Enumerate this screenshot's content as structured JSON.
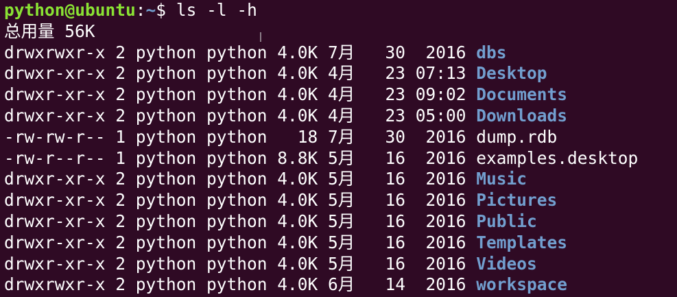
{
  "prompt": {
    "user_host": "python@ubuntu",
    "separator": ":",
    "path": "~",
    "symbol": "$",
    "command": " ls -l -h"
  },
  "total_line": "总用量 56K",
  "entries": [
    {
      "perms": "drwxrwxr-x",
      "links": "2",
      "owner": "python",
      "group": "python",
      "size": "4.0K",
      "month": "7月",
      "day": "30",
      "time": "2016",
      "name": "dbs",
      "type": "dir"
    },
    {
      "perms": "drwxr-xr-x",
      "links": "2",
      "owner": "python",
      "group": "python",
      "size": "4.0K",
      "month": "4月",
      "day": "23",
      "time": "07:13",
      "name": "Desktop",
      "type": "dir"
    },
    {
      "perms": "drwxr-xr-x",
      "links": "2",
      "owner": "python",
      "group": "python",
      "size": "4.0K",
      "month": "4月",
      "day": "23",
      "time": "09:02",
      "name": "Documents",
      "type": "dir"
    },
    {
      "perms": "drwxr-xr-x",
      "links": "2",
      "owner": "python",
      "group": "python",
      "size": "4.0K",
      "month": "4月",
      "day": "23",
      "time": "05:00",
      "name": "Downloads",
      "type": "dir"
    },
    {
      "perms": "-rw-rw-r--",
      "links": "1",
      "owner": "python",
      "group": "python",
      "size": "  18",
      "month": "7月",
      "day": "30",
      "time": "2016",
      "name": "dump.rdb",
      "type": "file"
    },
    {
      "perms": "-rw-r--r--",
      "links": "1",
      "owner": "python",
      "group": "python",
      "size": "8.8K",
      "month": "5月",
      "day": "16",
      "time": "2016",
      "name": "examples.desktop",
      "type": "file"
    },
    {
      "perms": "drwxr-xr-x",
      "links": "2",
      "owner": "python",
      "group": "python",
      "size": "4.0K",
      "month": "5月",
      "day": "16",
      "time": "2016",
      "name": "Music",
      "type": "dir"
    },
    {
      "perms": "drwxr-xr-x",
      "links": "2",
      "owner": "python",
      "group": "python",
      "size": "4.0K",
      "month": "5月",
      "day": "16",
      "time": "2016",
      "name": "Pictures",
      "type": "dir"
    },
    {
      "perms": "drwxr-xr-x",
      "links": "2",
      "owner": "python",
      "group": "python",
      "size": "4.0K",
      "month": "5月",
      "day": "16",
      "time": "2016",
      "name": "Public",
      "type": "dir"
    },
    {
      "perms": "drwxr-xr-x",
      "links": "2",
      "owner": "python",
      "group": "python",
      "size": "4.0K",
      "month": "5月",
      "day": "16",
      "time": "2016",
      "name": "Templates",
      "type": "dir"
    },
    {
      "perms": "drwxr-xr-x",
      "links": "2",
      "owner": "python",
      "group": "python",
      "size": "4.0K",
      "month": "5月",
      "day": "16",
      "time": "2016",
      "name": "Videos",
      "type": "dir"
    },
    {
      "perms": "drwxrwxr-x",
      "links": "2",
      "owner": "python",
      "group": "python",
      "size": "4.0K",
      "month": "6月",
      "day": "14",
      "time": "2016",
      "name": "workspace",
      "type": "dir"
    }
  ]
}
